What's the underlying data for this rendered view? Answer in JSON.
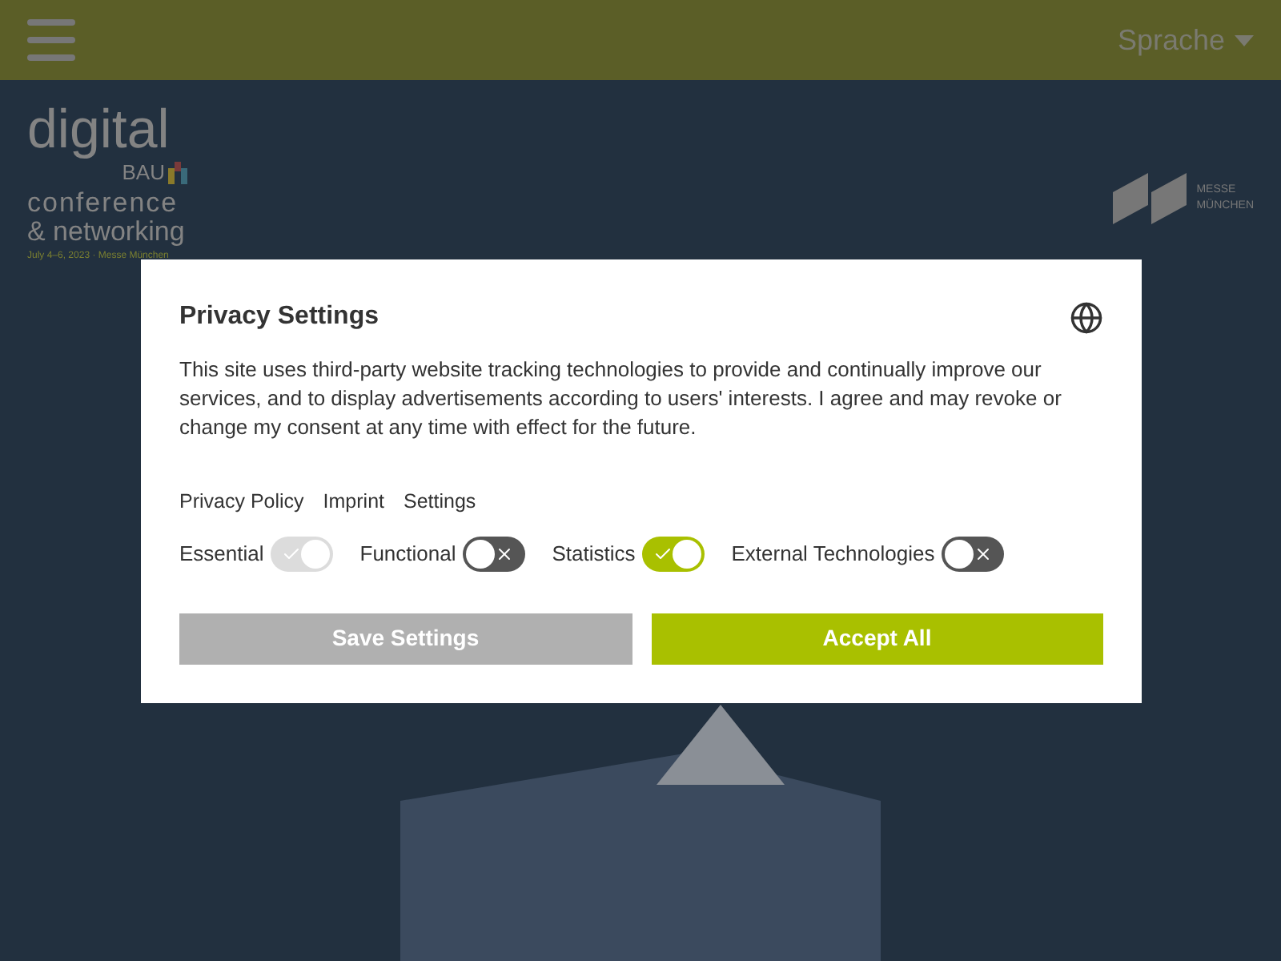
{
  "header": {
    "language_menu": {
      "label": "Sprache"
    }
  },
  "hero": {
    "logo": {
      "word": "digital",
      "sub": "BAU",
      "line1": "conference",
      "line2": "& networking",
      "date": "July 4–6, 2023 · Messe München"
    },
    "partner_logo": {
      "line1": "MESSE",
      "line2": "MÜNCHEN"
    }
  },
  "dialog": {
    "title": "Privacy Settings",
    "text": "This site uses third-party website tracking technologies to provide and continually improve our services, and to display advertisements according to users' interests. I agree and may revoke or change my consent at any time with effect for the future.",
    "links": [
      "Privacy Policy",
      "Imprint",
      "Settings"
    ],
    "toggles": [
      {
        "label": "Essential",
        "on": true,
        "disabled": true
      },
      {
        "label": "Functional",
        "on": false,
        "disabled": false
      },
      {
        "label": "Statistics",
        "on": true,
        "disabled": false
      },
      {
        "label": "External Technologies",
        "on": false,
        "disabled": false
      }
    ],
    "buttons": [
      {
        "label": "Save Settings",
        "kind": "secondary"
      },
      {
        "label": "Accept All",
        "kind": "primary"
      }
    ]
  }
}
